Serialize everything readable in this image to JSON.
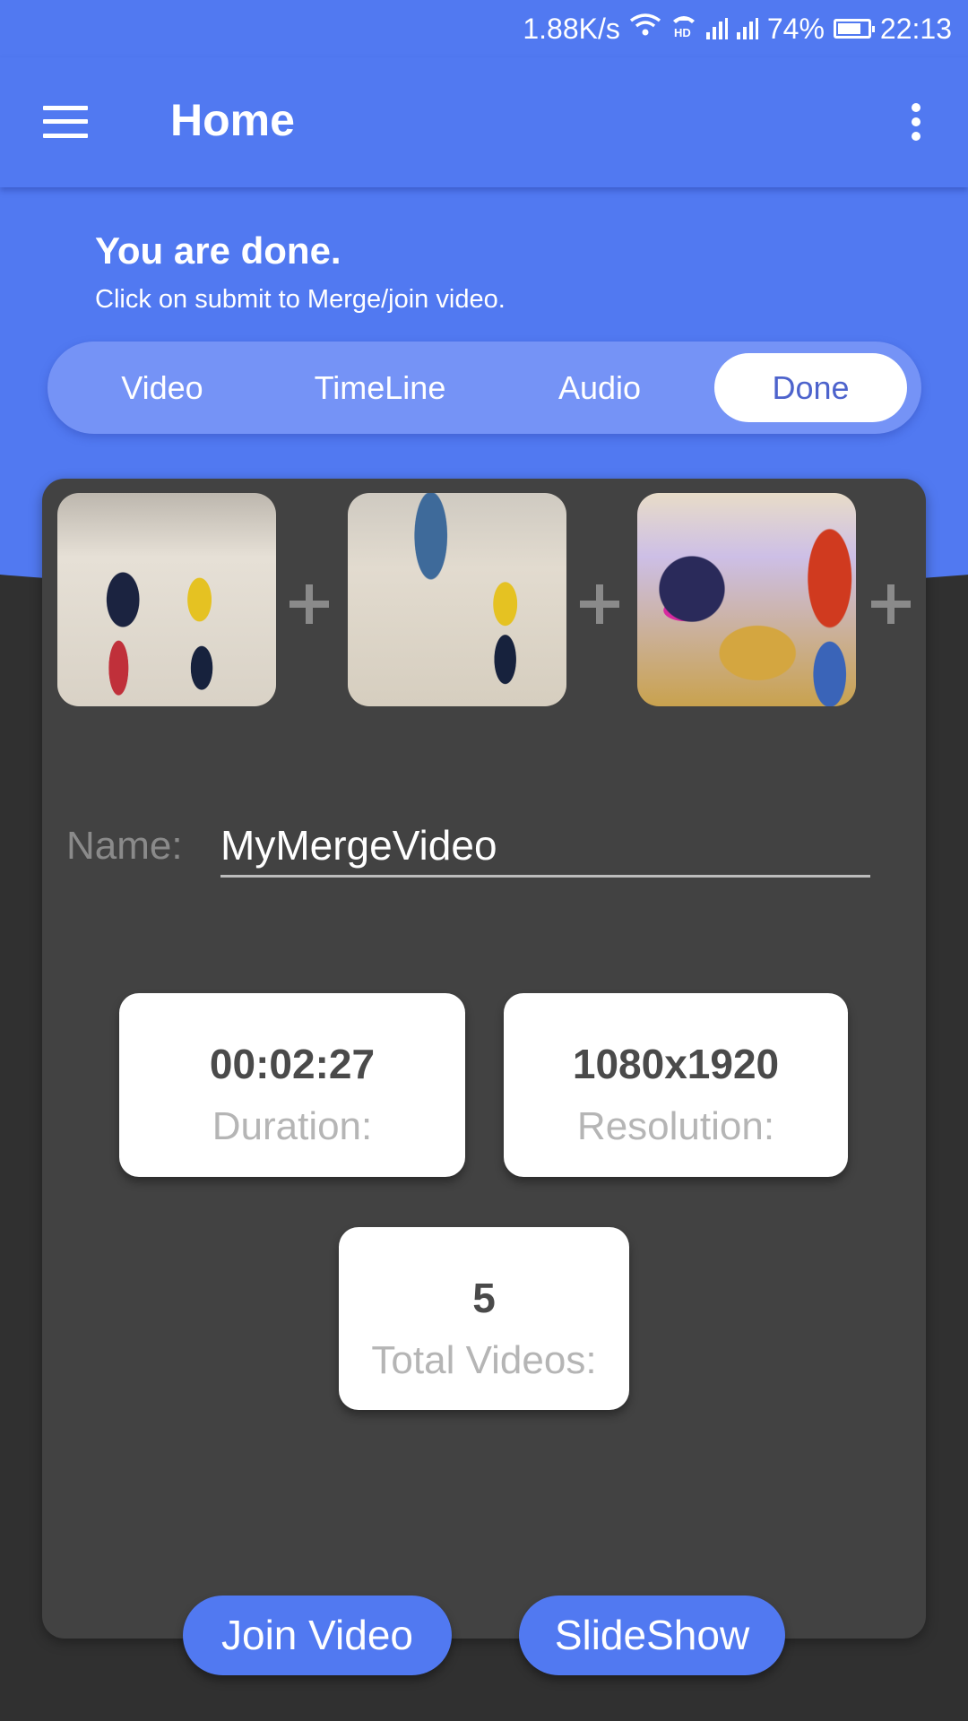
{
  "status_bar": {
    "net_speed": "1.88K/s",
    "battery_percent": "74%",
    "battery_level": 0.74,
    "time": "22:13",
    "icons": [
      "wifi-icon",
      "hd-call-icon",
      "signal-sim1-icon",
      "signal-sim2-icon",
      "battery-icon"
    ]
  },
  "toolbar": {
    "title": "Home",
    "menu_icon": "hamburger-menu-icon",
    "overflow_icon": "more-vert-icon"
  },
  "header": {
    "heading": "You are done.",
    "subheading": "Click on submit to Merge/join video."
  },
  "tabs": [
    {
      "label": "Video",
      "active": false
    },
    {
      "label": "TimeLine",
      "active": false
    },
    {
      "label": "Audio",
      "active": false
    },
    {
      "label": "Done",
      "active": true
    }
  ],
  "thumbnails": [
    {
      "description": "Two toddlers on a shiny airport floor"
    },
    {
      "description": "Toddler in yellow shirt standing near adult in jeans"
    },
    {
      "description": "Child in sunglasses sitting on a colorful bedspread"
    }
  ],
  "name_field": {
    "label": "Name:",
    "value": "MyMergeVideo"
  },
  "stats": {
    "duration": {
      "value": "00:02:27",
      "label": "Duration:"
    },
    "resolution": {
      "value": "1080x1920",
      "label": "Resolution:"
    },
    "total_videos": {
      "value": "5",
      "label": "Total Videos:"
    }
  },
  "buttons": {
    "join_video": "Join Video",
    "slideshow": "SlideShow"
  },
  "colors": {
    "primary": "#5179F1",
    "tab_track": "#7593F6",
    "active_tab_text": "#4D63CC",
    "card": "#424242",
    "background": "#303030"
  }
}
